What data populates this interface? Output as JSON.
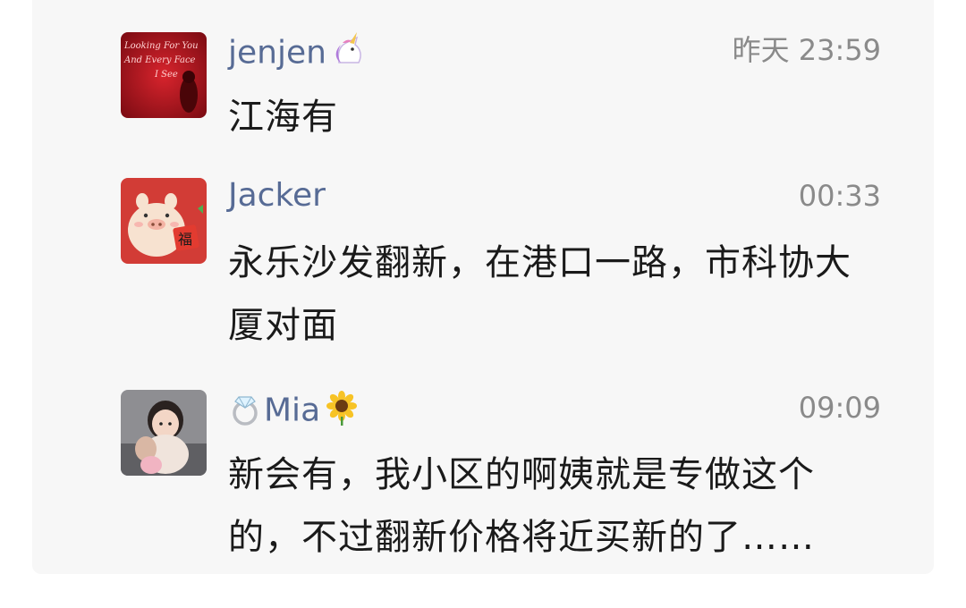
{
  "comments": [
    {
      "name": "jenjen",
      "name_suffix_icon": "unicorn-icon",
      "time": "昨天 23:59",
      "text": "江海有",
      "avatar_text": [
        "Looking For You",
        "And Every Face",
        "I See"
      ]
    },
    {
      "name": "Jacker",
      "time": "00:33",
      "text": "永乐沙发翻新，在港口一路，市科协大厦对面",
      "avatar_text": [
        "福"
      ]
    },
    {
      "name_prefix_icon": "ring-icon",
      "name": "Mia",
      "name_suffix_icon": "sunflower-icon",
      "time": "09:09",
      "text": "新会有，我小区的啊姨就是专做这个的，不过翻新价格将近买新的了……"
    }
  ],
  "colors": {
    "name": "#576b95",
    "time": "#8a8a8a",
    "text": "#1a1a1a",
    "panel": "#f7f7f7"
  }
}
